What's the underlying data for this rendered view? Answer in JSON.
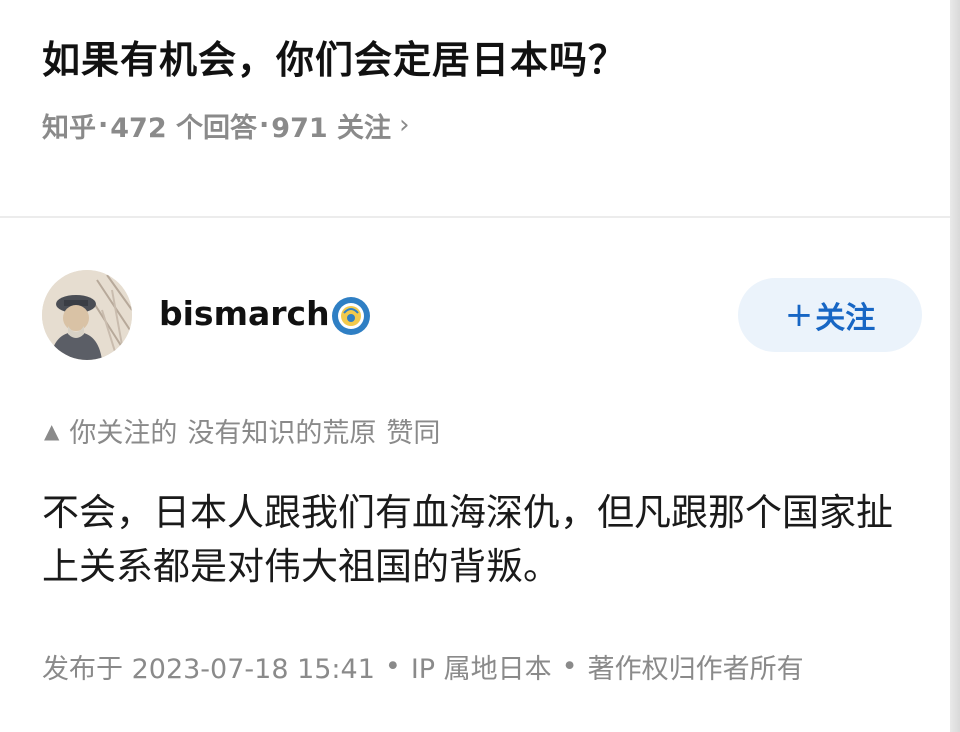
{
  "question": {
    "title": "如果有机会，你们会定居日本吗？",
    "source": "知乎",
    "answers": "472 个回答",
    "followers": "971 关注",
    "chevron": "›"
  },
  "author": {
    "name": "bismarch",
    "badge_icon": "achievement-badge-icon",
    "follow_label": "关注",
    "follow_plus": "+"
  },
  "endorsement": {
    "icon": "triangle-up-icon",
    "prefix": "你关注的",
    "user": "没有知识的荒原",
    "action": "赞同"
  },
  "answer": {
    "text": "不会，日本人跟我们有血海深仇，但凡跟那个国家扯上关系都是对伟大祖国的背叛。"
  },
  "footer": {
    "published": "发布于 2023-07-18 15:41",
    "ip": "IP 属地日本",
    "copyright": "著作权归作者所有"
  },
  "colors": {
    "accent": "#1766c4",
    "follow_bg": "#ebf3fb",
    "meta": "#8a8a8a"
  }
}
